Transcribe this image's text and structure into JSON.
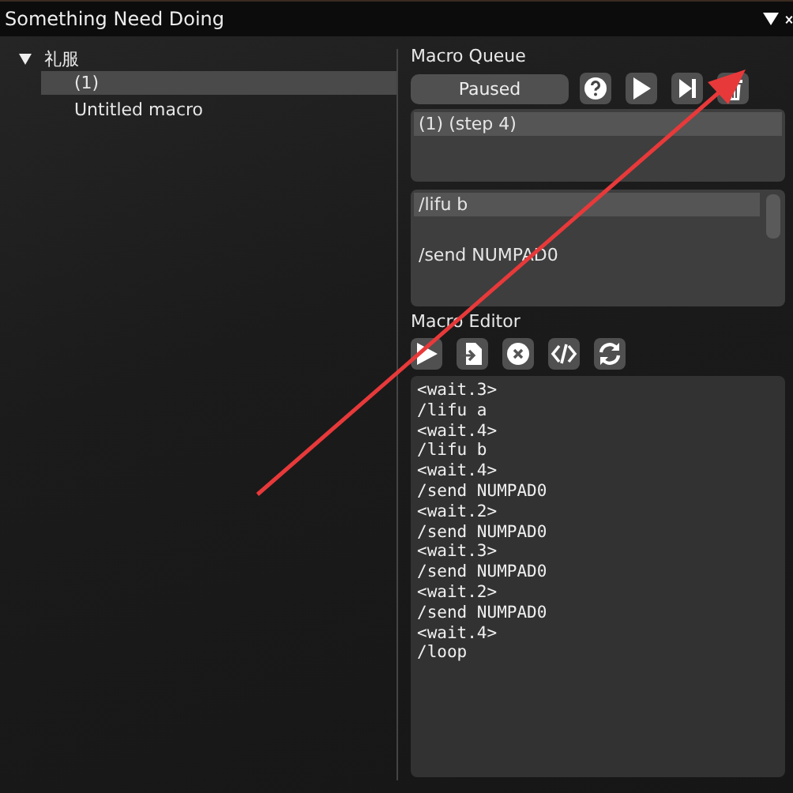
{
  "window": {
    "title": "Something Need Doing"
  },
  "tree": [
    {
      "label": "礼服",
      "expanded": true,
      "children": [
        {
          "label": "(1)",
          "selected": true
        },
        {
          "label": "Untitled macro",
          "selected": false
        }
      ]
    }
  ],
  "macro_queue": {
    "title": "Macro Queue",
    "status_button": "Paused",
    "tools": [
      {
        "kind": "help"
      },
      {
        "kind": "play"
      },
      {
        "kind": "step"
      },
      {
        "kind": "delete"
      }
    ],
    "items": [
      {
        "label": "(1) (step 4)",
        "selected": true
      }
    ],
    "lines": [
      {
        "text": "/lifu b",
        "selected": true
      },
      {
        "text": "/send NUMPAD0",
        "selected": false
      }
    ]
  },
  "macro_editor": {
    "title": "Macro Editor",
    "tools": [
      {
        "kind": "run"
      },
      {
        "kind": "import"
      },
      {
        "kind": "close"
      },
      {
        "kind": "code"
      },
      {
        "kind": "refresh"
      }
    ],
    "lines": [
      "<wait.3>",
      "/lifu a",
      "<wait.4>",
      "/lifu b",
      "<wait.4>",
      "/send NUMPAD0",
      "<wait.2>",
      "/send NUMPAD0",
      "<wait.3>",
      "/send NUMPAD0",
      "<wait.2>",
      "/send NUMPAD0",
      "<wait.4>",
      "/loop"
    ]
  }
}
